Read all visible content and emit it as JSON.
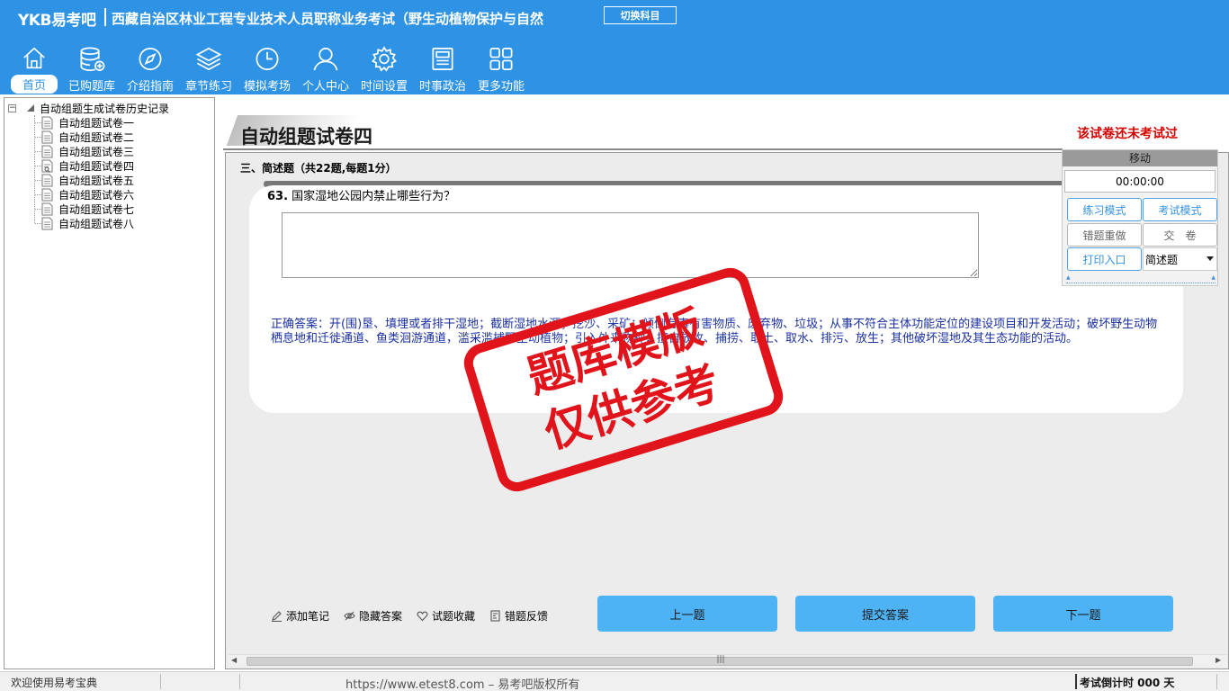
{
  "header": {
    "logo": "YKB易考吧",
    "title": "西藏自治区林业工程专业技术人员职称业务考试（野生动植物保护与自然",
    "switch_button": "切换科目",
    "nav": [
      {
        "label": "首页",
        "icon": "home-icon",
        "active": true
      },
      {
        "label": "已购题库",
        "icon": "database-icon",
        "active": false
      },
      {
        "label": "介绍指南",
        "icon": "compass-icon",
        "active": false
      },
      {
        "label": "章节练习",
        "icon": "layers-icon",
        "active": false
      },
      {
        "label": "模拟考场",
        "icon": "clock-icon",
        "active": false
      },
      {
        "label": "个人中心",
        "icon": "user-icon",
        "active": false
      },
      {
        "label": "时间设置",
        "icon": "gear-icon",
        "active": false
      },
      {
        "label": "时事政治",
        "icon": "news-icon",
        "active": false
      },
      {
        "label": "更多功能",
        "icon": "grid-icon",
        "active": false
      }
    ],
    "bg_color": "#2e92e5"
  },
  "tree": {
    "root": "自动组题生成试卷历史记录",
    "items": [
      "自动组题试卷一",
      "自动组题试卷二",
      "自动组题试卷三",
      "自动组题试卷四",
      "自动组题试卷五",
      "自动组题试卷六",
      "自动组题试卷七",
      "自动组题试卷八"
    ],
    "selected_index": 3
  },
  "main": {
    "title": "自动组题试卷四",
    "status": "该试卷还未考试过",
    "section": "三、简述题（共22题,每题1分）",
    "question_number": "63.",
    "question_text": "国家湿地公园内禁止哪些行为？",
    "answer": "正确答案：开(围)垦、填埋或者排干湿地；截断湿地水源；挖沙、采矿；倾倒有毒有害物质、废弃物、垃圾；从事不符合主体功能定位的建设项目和开发活动；破坏野生动物栖息地和迁徙通道、鱼类洄游通道，滥采滥捕野生动植物；引入外来物种；擅自放牧、捕捞、取土、取水、排污、放生；其他破坏湿地及其生态功能的活动。",
    "utilities": [
      {
        "label": "添加笔记",
        "icon": "pencil-icon"
      },
      {
        "label": "隐藏答案",
        "icon": "eye-icon"
      },
      {
        "label": "试题收藏",
        "icon": "heart-icon"
      },
      {
        "label": "错题反馈",
        "icon": "feedback-icon"
      }
    ],
    "prev_button": "上一题",
    "submit_button": "提交答案",
    "next_button": "下一题"
  },
  "control": {
    "move_label": "移动",
    "timer": "00:00:00",
    "practice_mode": "练习模式",
    "exam_mode": "考试模式",
    "redo_wrong": "错题重做",
    "submit_paper": "交　卷",
    "print_entry": "打印入口",
    "question_type": "简述题"
  },
  "stamp": {
    "line1": "题库模版",
    "line2": "仅供参考",
    "color": "#e0141a"
  },
  "status_bar": {
    "welcome": "欢迎使用易考宝典",
    "copyright": "https://www.etest8.com – 易考吧版权所有",
    "countdown": "考试倒计时 000 天"
  }
}
